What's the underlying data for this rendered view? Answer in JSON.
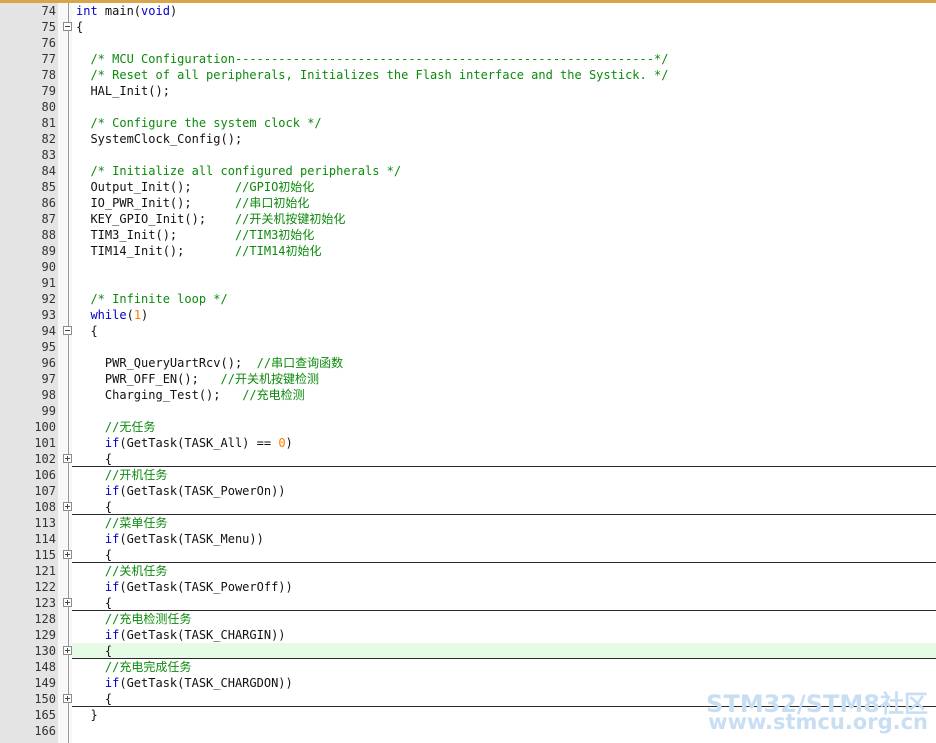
{
  "lines": [
    {
      "n": "74",
      "fold": "",
      "hl": false,
      "sep": false,
      "indent": 0,
      "parts": [
        {
          "t": "int",
          "c": "kw"
        },
        {
          "t": " main(",
          "c": ""
        },
        {
          "t": "void",
          "c": "kw"
        },
        {
          "t": ")",
          "c": ""
        }
      ]
    },
    {
      "n": "75",
      "fold": "minus",
      "hl": false,
      "sep": false,
      "indent": 0,
      "parts": [
        {
          "t": "{",
          "c": ""
        }
      ]
    },
    {
      "n": "76",
      "fold": "",
      "hl": false,
      "sep": false,
      "indent": 0,
      "parts": []
    },
    {
      "n": "77",
      "fold": "",
      "hl": false,
      "sep": false,
      "indent": 2,
      "parts": [
        {
          "t": "/* MCU Configuration----------------------------------------------------------*/",
          "c": "cm"
        }
      ]
    },
    {
      "n": "78",
      "fold": "",
      "hl": false,
      "sep": false,
      "indent": 2,
      "parts": [
        {
          "t": "/* Reset of all peripherals, Initializes the Flash interface and the Systick. */",
          "c": "cm"
        }
      ]
    },
    {
      "n": "79",
      "fold": "",
      "hl": false,
      "sep": false,
      "indent": 2,
      "parts": [
        {
          "t": "HAL_Init();",
          "c": ""
        }
      ]
    },
    {
      "n": "80",
      "fold": "",
      "hl": false,
      "sep": false,
      "indent": 0,
      "parts": []
    },
    {
      "n": "81",
      "fold": "",
      "hl": false,
      "sep": false,
      "indent": 2,
      "parts": [
        {
          "t": "/* Configure the system clock */",
          "c": "cm"
        }
      ]
    },
    {
      "n": "82",
      "fold": "",
      "hl": false,
      "sep": false,
      "indent": 2,
      "parts": [
        {
          "t": "SystemClock_Config();",
          "c": ""
        }
      ]
    },
    {
      "n": "83",
      "fold": "",
      "hl": false,
      "sep": false,
      "indent": 0,
      "parts": []
    },
    {
      "n": "84",
      "fold": "",
      "hl": false,
      "sep": false,
      "indent": 2,
      "parts": [
        {
          "t": "/* Initialize all configured peripherals */",
          "c": "cm"
        }
      ]
    },
    {
      "n": "85",
      "fold": "",
      "hl": false,
      "sep": false,
      "indent": 2,
      "parts": [
        {
          "t": "Output_Init();      ",
          "c": ""
        },
        {
          "t": "//GPIO初始化",
          "c": "cm"
        }
      ]
    },
    {
      "n": "86",
      "fold": "",
      "hl": false,
      "sep": false,
      "indent": 2,
      "parts": [
        {
          "t": "IO_PWR_Init();      ",
          "c": ""
        },
        {
          "t": "//串口初始化",
          "c": "cm"
        }
      ]
    },
    {
      "n": "87",
      "fold": "",
      "hl": false,
      "sep": false,
      "indent": 2,
      "parts": [
        {
          "t": "KEY_GPIO_Init();    ",
          "c": ""
        },
        {
          "t": "//开关机按键初始化",
          "c": "cm"
        }
      ]
    },
    {
      "n": "88",
      "fold": "",
      "hl": false,
      "sep": false,
      "indent": 2,
      "parts": [
        {
          "t": "TIM3_Init();        ",
          "c": ""
        },
        {
          "t": "//TIM3初始化",
          "c": "cm"
        }
      ]
    },
    {
      "n": "89",
      "fold": "",
      "hl": false,
      "sep": false,
      "indent": 2,
      "parts": [
        {
          "t": "TIM14_Init();       ",
          "c": ""
        },
        {
          "t": "//TIM14初始化",
          "c": "cm"
        }
      ]
    },
    {
      "n": "90",
      "fold": "",
      "hl": false,
      "sep": false,
      "indent": 0,
      "parts": []
    },
    {
      "n": "91",
      "fold": "",
      "hl": false,
      "sep": false,
      "indent": 0,
      "parts": []
    },
    {
      "n": "92",
      "fold": "",
      "hl": false,
      "sep": false,
      "indent": 2,
      "parts": [
        {
          "t": "/* Infinite loop */",
          "c": "cm"
        }
      ]
    },
    {
      "n": "93",
      "fold": "",
      "hl": false,
      "sep": false,
      "indent": 2,
      "parts": [
        {
          "t": "while",
          "c": "kw"
        },
        {
          "t": "(",
          "c": ""
        },
        {
          "t": "1",
          "c": "num"
        },
        {
          "t": ")",
          "c": ""
        }
      ]
    },
    {
      "n": "94",
      "fold": "minus",
      "hl": false,
      "sep": false,
      "indent": 2,
      "parts": [
        {
          "t": "{",
          "c": ""
        }
      ]
    },
    {
      "n": "95",
      "fold": "",
      "hl": false,
      "sep": false,
      "indent": 0,
      "parts": []
    },
    {
      "n": "96",
      "fold": "",
      "hl": false,
      "sep": false,
      "indent": 4,
      "parts": [
        {
          "t": "PWR_QueryUartRcv();  ",
          "c": ""
        },
        {
          "t": "//串口查询函数",
          "c": "cm"
        }
      ]
    },
    {
      "n": "97",
      "fold": "",
      "hl": false,
      "sep": false,
      "indent": 4,
      "parts": [
        {
          "t": "PWR_OFF_EN();   ",
          "c": ""
        },
        {
          "t": "//开关机按键检测",
          "c": "cm"
        }
      ]
    },
    {
      "n": "98",
      "fold": "",
      "hl": false,
      "sep": false,
      "indent": 4,
      "parts": [
        {
          "t": "Charging_Test();   ",
          "c": ""
        },
        {
          "t": "//充电检测",
          "c": "cm"
        }
      ]
    },
    {
      "n": "99",
      "fold": "",
      "hl": false,
      "sep": false,
      "indent": 0,
      "parts": []
    },
    {
      "n": "100",
      "fold": "",
      "hl": false,
      "sep": false,
      "indent": 4,
      "parts": [
        {
          "t": "//无任务",
          "c": "cm"
        }
      ]
    },
    {
      "n": "101",
      "fold": "",
      "hl": false,
      "sep": false,
      "indent": 4,
      "parts": [
        {
          "t": "if",
          "c": "kw"
        },
        {
          "t": "(GetTask(TASK_All) == ",
          "c": ""
        },
        {
          "t": "0",
          "c": "num"
        },
        {
          "t": ")",
          "c": ""
        }
      ]
    },
    {
      "n": "102",
      "fold": "plus",
      "hl": false,
      "sep": true,
      "indent": 4,
      "parts": [
        {
          "t": "{",
          "c": ""
        }
      ]
    },
    {
      "n": "106",
      "fold": "",
      "hl": false,
      "sep": false,
      "indent": 4,
      "parts": [
        {
          "t": "//开机任务",
          "c": "cm"
        }
      ]
    },
    {
      "n": "107",
      "fold": "",
      "hl": false,
      "sep": false,
      "indent": 4,
      "parts": [
        {
          "t": "if",
          "c": "kw"
        },
        {
          "t": "(GetTask(TASK_PowerOn))",
          "c": ""
        }
      ]
    },
    {
      "n": "108",
      "fold": "plus",
      "hl": false,
      "sep": true,
      "indent": 4,
      "parts": [
        {
          "t": "{",
          "c": ""
        }
      ]
    },
    {
      "n": "113",
      "fold": "",
      "hl": false,
      "sep": false,
      "indent": 4,
      "parts": [
        {
          "t": "//菜单任务",
          "c": "cm"
        }
      ]
    },
    {
      "n": "114",
      "fold": "",
      "hl": false,
      "sep": false,
      "indent": 4,
      "parts": [
        {
          "t": "if",
          "c": "kw"
        },
        {
          "t": "(GetTask(TASK_Menu))",
          "c": ""
        }
      ]
    },
    {
      "n": "115",
      "fold": "plus",
      "hl": false,
      "sep": true,
      "indent": 4,
      "parts": [
        {
          "t": "{",
          "c": ""
        }
      ]
    },
    {
      "n": "121",
      "fold": "",
      "hl": false,
      "sep": false,
      "indent": 4,
      "parts": [
        {
          "t": "//关机任务",
          "c": "cm"
        }
      ]
    },
    {
      "n": "122",
      "fold": "",
      "hl": false,
      "sep": false,
      "indent": 4,
      "parts": [
        {
          "t": "if",
          "c": "kw"
        },
        {
          "t": "(GetTask(TASK_PowerOff))",
          "c": ""
        }
      ]
    },
    {
      "n": "123",
      "fold": "plus",
      "hl": false,
      "sep": true,
      "indent": 4,
      "parts": [
        {
          "t": "{",
          "c": ""
        }
      ]
    },
    {
      "n": "128",
      "fold": "",
      "hl": false,
      "sep": false,
      "indent": 4,
      "parts": [
        {
          "t": "//充电检测任务",
          "c": "cm"
        }
      ]
    },
    {
      "n": "129",
      "fold": "",
      "hl": false,
      "sep": false,
      "indent": 4,
      "parts": [
        {
          "t": "if",
          "c": "kw"
        },
        {
          "t": "(GetTask(TASK_CHARGIN))",
          "c": ""
        }
      ]
    },
    {
      "n": "130",
      "fold": "plus",
      "hl": true,
      "sep": true,
      "indent": 4,
      "parts": [
        {
          "t": "{",
          "c": ""
        }
      ]
    },
    {
      "n": "148",
      "fold": "",
      "hl": false,
      "sep": false,
      "indent": 4,
      "parts": [
        {
          "t": "//充电完成任务",
          "c": "cm"
        }
      ]
    },
    {
      "n": "149",
      "fold": "",
      "hl": false,
      "sep": false,
      "indent": 4,
      "parts": [
        {
          "t": "if",
          "c": "kw"
        },
        {
          "t": "(GetTask(TASK_CHARGDON))",
          "c": ""
        }
      ]
    },
    {
      "n": "150",
      "fold": "plus",
      "hl": false,
      "sep": true,
      "indent": 4,
      "parts": [
        {
          "t": "{",
          "c": ""
        }
      ]
    },
    {
      "n": "165",
      "fold": "",
      "hl": false,
      "sep": false,
      "indent": 2,
      "parts": [
        {
          "t": "}",
          "c": ""
        }
      ]
    },
    {
      "n": "166",
      "fold": "",
      "hl": false,
      "sep": false,
      "indent": 0,
      "parts": []
    }
  ],
  "watermark": {
    "line1": "STM32/STM8社区",
    "line2": "www.stmcu.org.cn"
  },
  "colors": {
    "keyword": "#0000cc",
    "comment": "#0c8a0c",
    "number": "#ff7a00",
    "current_line": "#e6fbe6",
    "gutter": "#e4e4e4"
  }
}
